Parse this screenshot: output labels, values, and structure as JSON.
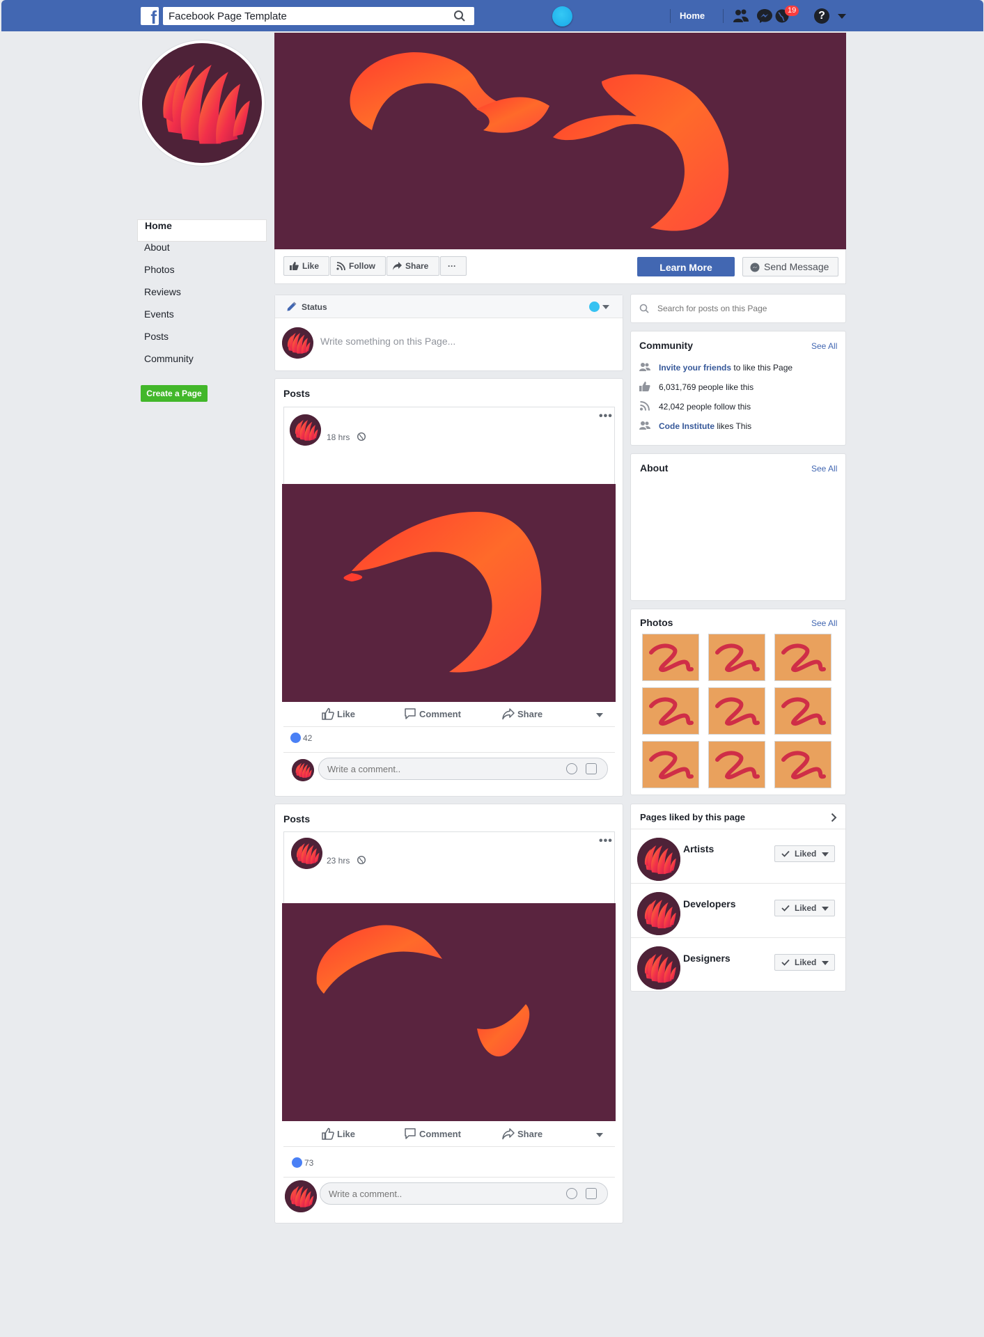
{
  "topbar": {
    "search_value": "Facebook Page Template",
    "home_label": "Home",
    "notification_count": "19",
    "help_glyph": "?",
    "logo_glyph": "f"
  },
  "colors": {
    "brand_blue": "#4267b2",
    "cover_maroon": "#5a243f",
    "create_green": "#42b72a",
    "photo_tile": "#e9a15d"
  },
  "sidebar": {
    "items": [
      {
        "label": "Home",
        "active": true
      },
      {
        "label": "About"
      },
      {
        "label": "Photos"
      },
      {
        "label": "Reviews"
      },
      {
        "label": "Events"
      },
      {
        "label": "Posts"
      },
      {
        "label": "Community"
      }
    ],
    "create_page_label": "Create a Page"
  },
  "actions": {
    "like": "Like",
    "follow": "Follow",
    "share": "Share",
    "more": "···",
    "learn_more": "Learn More",
    "send_message": "Send Message"
  },
  "composer": {
    "status_label": "Status",
    "placeholder": "Write something on this Page..."
  },
  "posts": [
    {
      "section_title": "Posts",
      "time": "18 hrs",
      "like_label": "Like",
      "comment_label": "Comment",
      "share_label": "Share",
      "likes": "42",
      "comment_placeholder": "Write a comment.."
    },
    {
      "section_title": "Posts",
      "time": "23 hrs",
      "like_label": "Like",
      "comment_label": "Comment",
      "share_label": "Share",
      "likes": "73",
      "comment_placeholder": "Write a comment.."
    }
  ],
  "right": {
    "search_placeholder": "Search for posts on this Page",
    "community": {
      "title": "Community",
      "see_all": "See All",
      "invite_link": "Invite your friends",
      "invite_rest": " to like this Page",
      "likes_text": "6,031,769 people like this",
      "follows_text": "42,042 people follow this",
      "ci_link": "Code Institute",
      "ci_rest": " likes This"
    },
    "about": {
      "title": "About",
      "see_all": "See All"
    },
    "photos": {
      "title": "Photos",
      "see_all": "See All"
    },
    "pages_liked": {
      "title": "Pages liked by this page",
      "liked_label": "Liked",
      "pages": [
        {
          "name": "Artists"
        },
        {
          "name": "Developers"
        },
        {
          "name": "Designers"
        }
      ]
    }
  }
}
